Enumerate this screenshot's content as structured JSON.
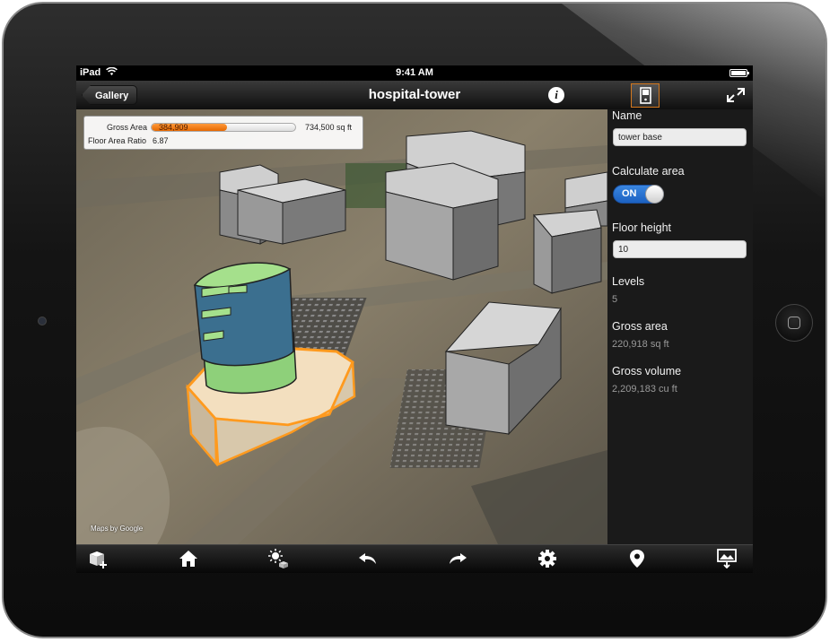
{
  "status_bar": {
    "carrier": "iPad",
    "time": "9:41 AM"
  },
  "nav": {
    "back_label": "Gallery",
    "title": "hospital-tower",
    "info_icon": "info-icon",
    "panel_icon": "properties-panel-icon",
    "expand_icon": "fullscreen-icon"
  },
  "stats": {
    "gross_area_label": "Gross Area",
    "gross_area_value": "384,909",
    "gross_area_max": "734,500 sq ft",
    "gross_area_fraction": 0.524,
    "far_label": "Floor Area Ratio",
    "far_value": "6.87"
  },
  "map": {
    "credit": "Maps by Google"
  },
  "panel": {
    "name_label": "Name",
    "name_value": "tower base",
    "calc_label": "Calculate area",
    "calc_toggle": "ON",
    "floor_height_label": "Floor height",
    "floor_height_value": "10",
    "levels_label": "Levels",
    "levels_value": "5",
    "gross_area_label": "Gross area",
    "gross_area_value": "220,918 sq ft",
    "gross_volume_label": "Gross volume",
    "gross_volume_value": "2,209,183 cu ft"
  },
  "toolbar": {
    "icons": [
      "add-building-icon",
      "home-icon",
      "sun-shadow-icon",
      "undo-icon",
      "redo-icon",
      "settings-gear-icon",
      "location-pin-icon",
      "share-image-icon"
    ]
  },
  "colors": {
    "accent_orange": "#e56800",
    "toggle_blue": "#2a74d6",
    "selection_outline": "#ff9a1e",
    "tower_blue": "#3b6f8f",
    "tower_green": "#8ed07a"
  }
}
